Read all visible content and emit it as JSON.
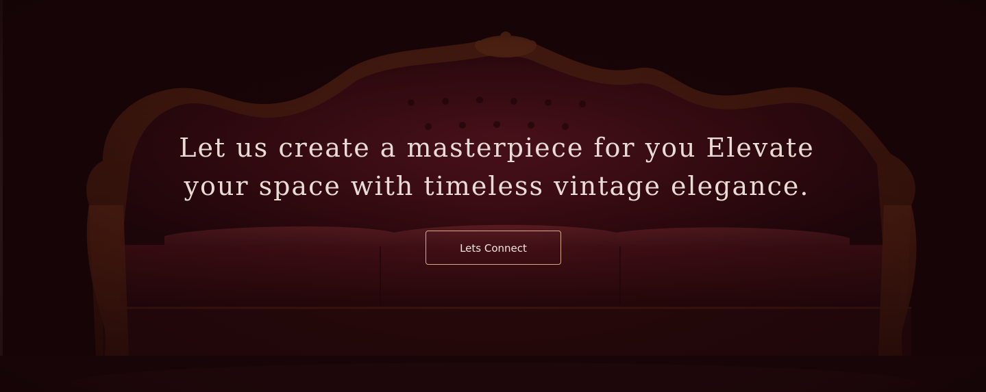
{
  "hero": {
    "headline": "Let us create a masterpiece for you Elevate your space with timeless vintage elegance.",
    "cta_label": "Lets Connect",
    "image": "vintage-sofa-background"
  },
  "colors": {
    "background": "#1a0507",
    "sofa_upholstery": "#5a1420",
    "sofa_wood": "#5b2412",
    "text": "#e9dcd6",
    "button_border": "#d9a98c"
  }
}
